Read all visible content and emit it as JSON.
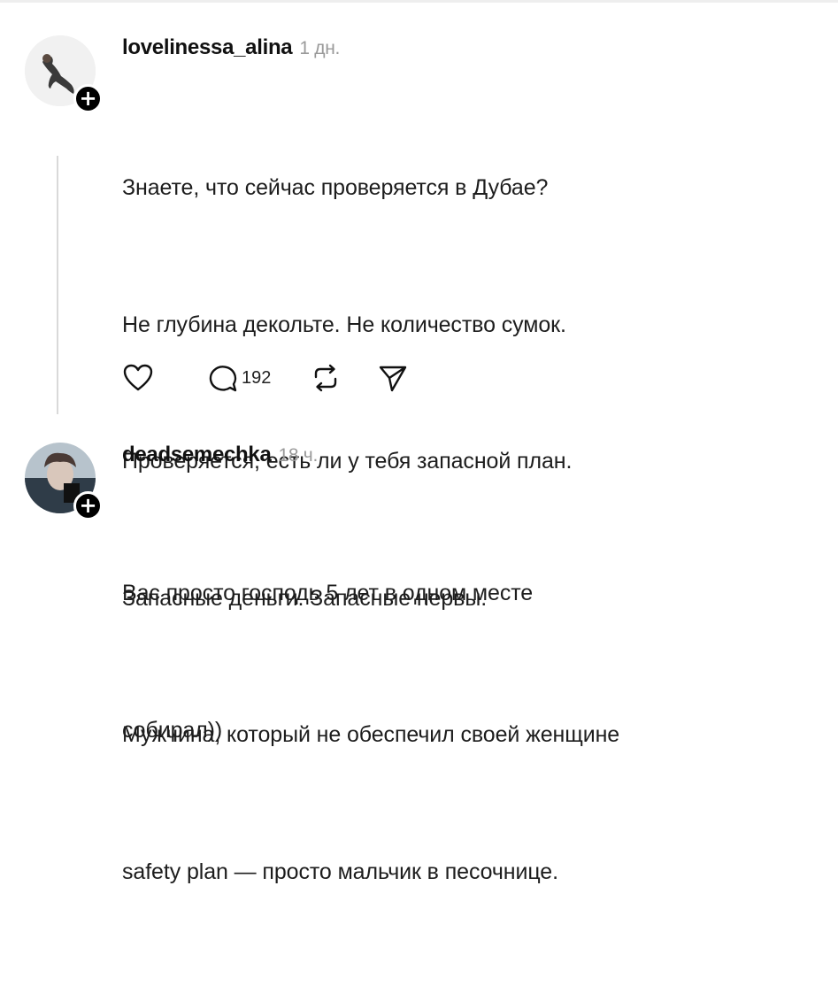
{
  "comments": [
    {
      "username": "lovelinessa_alina",
      "time": "1 дн.",
      "lines": [
        "Знаете, что сейчас проверяется в Дубае?",
        "Не глубина декольте. Не количество сумок.",
        "Проверяется, есть ли у тебя запасной план.",
        "Запасные деньги. Запасные нервы.",
        "Мужчина, который не обеспечил своей женщине",
        "safety plan — просто мальчик в песочнице."
      ],
      "actions": {
        "like_icon": "heart-icon",
        "comment_icon": "comment-bubble-icon",
        "comment_count": "192",
        "repost_icon": "repost-icon",
        "share_icon": "share-icon"
      }
    },
    {
      "username": "deadsemechka",
      "time": "18 ч.",
      "lines": [
        "Вас просто господь 5 лет в одном месте",
        "собирал))"
      ]
    }
  ],
  "follow_badge": "+",
  "colors": {
    "text": "#1d1d1d",
    "muted": "#9a9a9a",
    "badge": "#000000",
    "thread_line": "#d9d9d9"
  }
}
